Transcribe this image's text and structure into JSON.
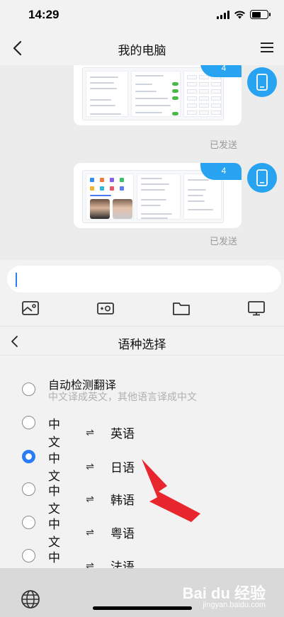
{
  "status_bar": {
    "time": "14:29"
  },
  "nav": {
    "title": "我的电脑"
  },
  "chat": {
    "messages": [
      {
        "badge": "4",
        "status": "已发送"
      },
      {
        "badge": "4",
        "status": "已发送"
      }
    ]
  },
  "input": {
    "placeholder": ""
  },
  "toolbar": {
    "icons": [
      "image-icon",
      "video-camera-icon",
      "folder-icon",
      "monitor-icon"
    ]
  },
  "language_panel": {
    "title": "语种选择",
    "auto_option": {
      "title": "自动检测翻译",
      "desc": "中文译成英文，其他语言译成中文"
    },
    "swap_symbol": "⇌",
    "pairs": [
      {
        "from": "中文",
        "to": "英语",
        "selected": false
      },
      {
        "from": "中文",
        "to": "日语",
        "selected": true
      },
      {
        "from": "中文",
        "to": "韩语",
        "selected": false
      },
      {
        "from": "中文",
        "to": "粤语",
        "selected": false
      },
      {
        "from": "中文",
        "to": "法语",
        "selected": false
      }
    ]
  },
  "watermark": {
    "main": "Bai du 经验",
    "sub": "jingyan.baidu.com"
  },
  "colors": {
    "accent": "#2a7cf6",
    "badge": "#27a3f1",
    "arrow": "#e8262e"
  }
}
